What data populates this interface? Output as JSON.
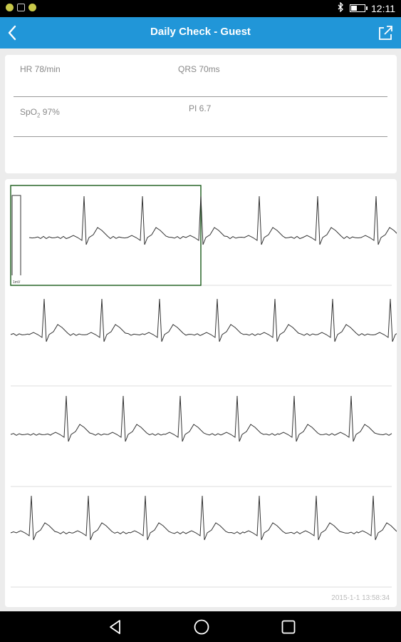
{
  "status_bar": {
    "time": "12:11",
    "icons": [
      "notification-dot-icon",
      "grid-app-icon",
      "notification-dot-icon",
      "bluetooth-icon",
      "battery-icon"
    ]
  },
  "app_bar": {
    "title": "Daily Check - Guest",
    "back_icon": "back-chevron-icon",
    "share_icon": "share-icon",
    "color": "#2196d8"
  },
  "metrics": {
    "hr": "HR 78/min",
    "qrs": "QRS 70ms",
    "spo2_prefix": "SpO",
    "spo2_sub": "2",
    "spo2_value": " 97%",
    "pi": "PI 6.7"
  },
  "ecg": {
    "calibration_label": "1mV",
    "rows": 4,
    "timestamp": "2015-1-1 13:58:34",
    "highlight_color": "#1a5a1a"
  },
  "nav_bar": {
    "icons": [
      "nav-back-icon",
      "nav-home-icon",
      "nav-recents-icon"
    ]
  }
}
